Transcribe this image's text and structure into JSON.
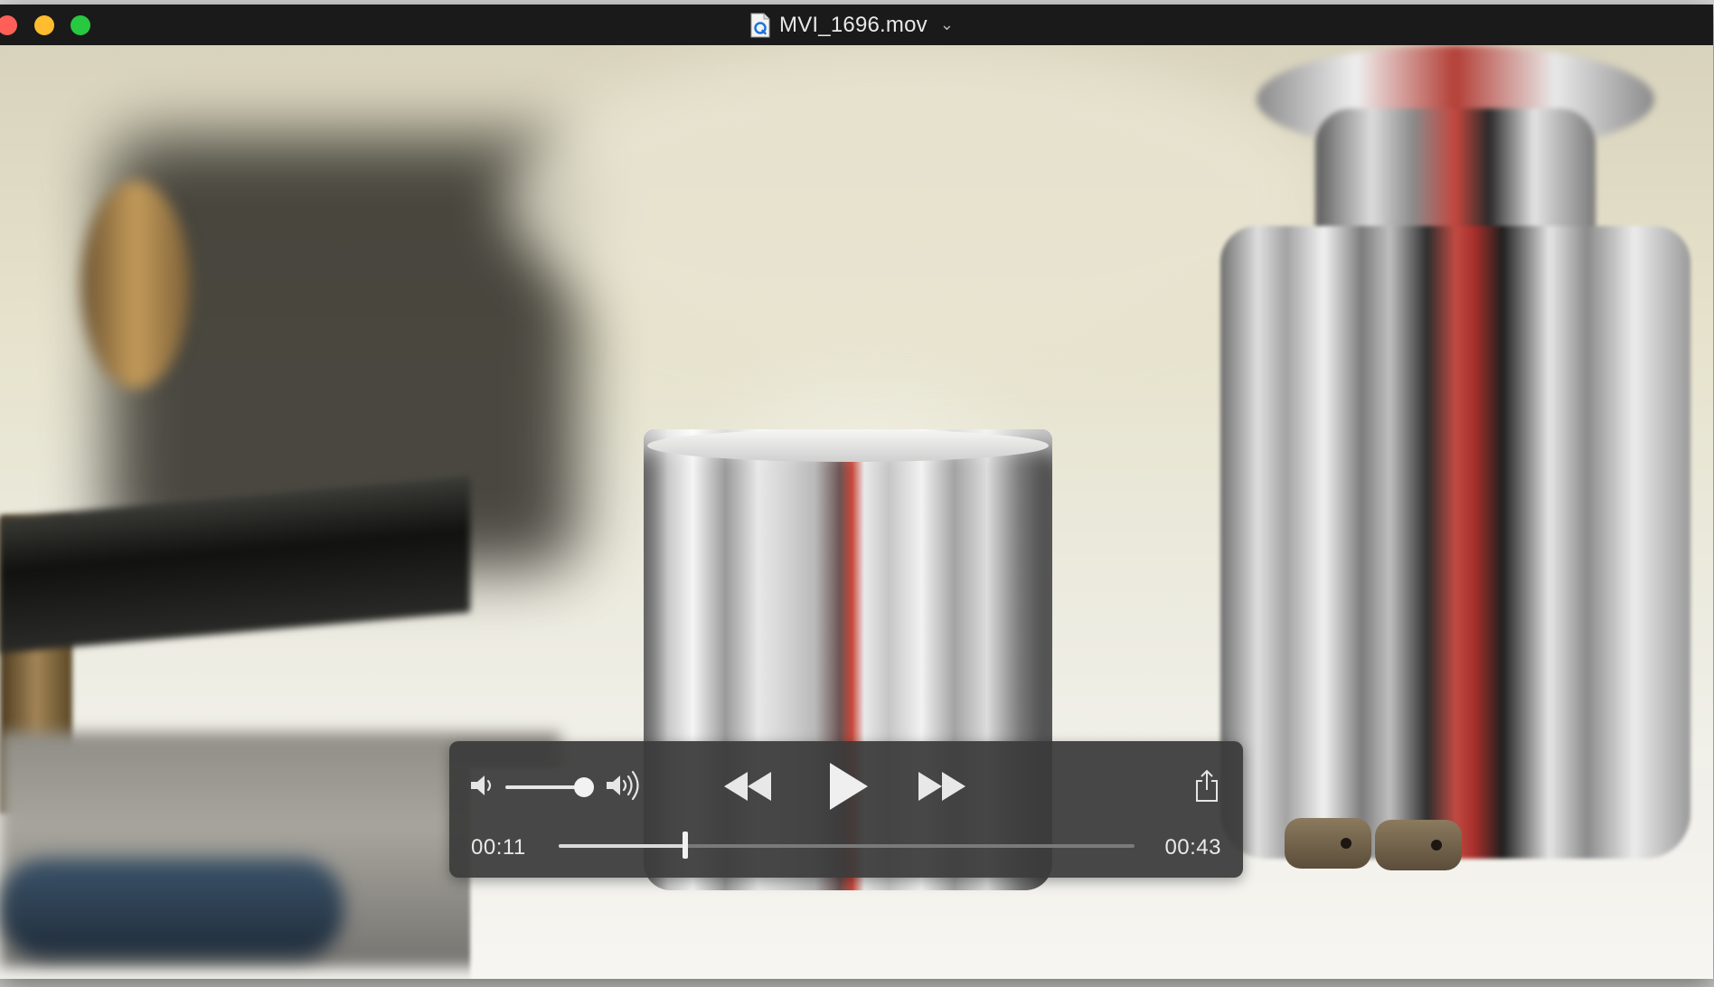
{
  "window": {
    "title": "MVI_1696.mov",
    "title_chevron": "chevron-down-icon",
    "file_icon": "quicktime-document-icon"
  },
  "player": {
    "current_time": "00:11",
    "duration": "00:43",
    "progress_fraction": 0.22,
    "volume_fraction": 0.8,
    "controls": {
      "volume_low_icon": "speaker-low-icon",
      "volume_high_icon": "speaker-high-icon",
      "rewind_icon": "rewind-icon",
      "play_icon": "play-icon",
      "fast_forward_icon": "fast-forward-icon",
      "share_icon": "share-icon"
    }
  },
  "colors": {
    "close": "#fe5f57",
    "minimize": "#febc2e",
    "maximize": "#28c840",
    "hud_background": "#3a3a3a",
    "hud_text": "#e9e9e9"
  }
}
